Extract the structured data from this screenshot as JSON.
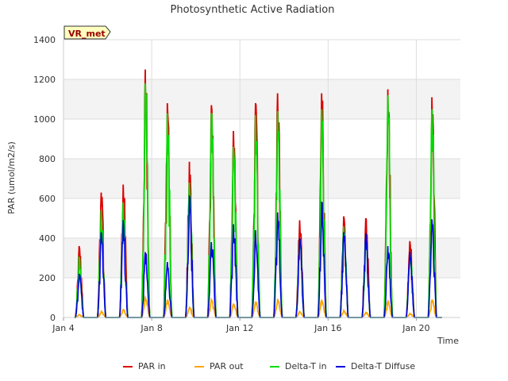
{
  "chart_data": {
    "type": "line",
    "title": "Photosynthetic Active Radiation",
    "xlabel": "Time",
    "ylabel": "PAR (umol/m2/s)",
    "site_label": "VR_met",
    "ylim": [
      0,
      1400
    ],
    "yticks": [
      0,
      200,
      400,
      600,
      800,
      1000,
      1200,
      1400
    ],
    "xlim": [
      "2024-01-04",
      "2024-01-22"
    ],
    "xticks": [
      {
        "date": "2024-01-04",
        "label": "Jan 4"
      },
      {
        "date": "2024-01-08",
        "label": "Jan 8"
      },
      {
        "date": "2024-01-12",
        "label": "Jan 12"
      },
      {
        "date": "2024-01-16",
        "label": "Jan 16"
      },
      {
        "date": "2024-01-20",
        "label": "Jan 20"
      }
    ],
    "grid": true,
    "legend_position": "bottom",
    "series": [
      {
        "name": "PAR in",
        "color": "#dd0000",
        "daily_peak": [
          {
            "date": "2024-01-04",
            "value": 360
          },
          {
            "date": "2024-01-05",
            "value": 630
          },
          {
            "date": "2024-01-06",
            "value": 670
          },
          {
            "date": "2024-01-07",
            "value": 1250
          },
          {
            "date": "2024-01-08",
            "value": 1080
          },
          {
            "date": "2024-01-09",
            "value": 785
          },
          {
            "date": "2024-01-10",
            "value": 1070
          },
          {
            "date": "2024-01-11",
            "value": 940
          },
          {
            "date": "2024-01-12",
            "value": 1080
          },
          {
            "date": "2024-01-13",
            "value": 1130
          },
          {
            "date": "2024-01-14",
            "value": 490
          },
          {
            "date": "2024-01-15",
            "value": 1130
          },
          {
            "date": "2024-01-16",
            "value": 510
          },
          {
            "date": "2024-01-17",
            "value": 500
          },
          {
            "date": "2024-01-18",
            "value": 1150
          },
          {
            "date": "2024-01-19",
            "value": 385
          },
          {
            "date": "2024-01-20",
            "value": 1110
          }
        ]
      },
      {
        "name": "PAR out",
        "color": "#ffa500",
        "daily_peak": [
          {
            "date": "2024-01-04",
            "value": 15
          },
          {
            "date": "2024-01-05",
            "value": 30
          },
          {
            "date": "2024-01-06",
            "value": 40
          },
          {
            "date": "2024-01-07",
            "value": 100
          },
          {
            "date": "2024-01-08",
            "value": 90
          },
          {
            "date": "2024-01-09",
            "value": 50
          },
          {
            "date": "2024-01-10",
            "value": 90
          },
          {
            "date": "2024-01-11",
            "value": 70
          },
          {
            "date": "2024-01-12",
            "value": 80
          },
          {
            "date": "2024-01-13",
            "value": 90
          },
          {
            "date": "2024-01-14",
            "value": 30
          },
          {
            "date": "2024-01-15",
            "value": 90
          },
          {
            "date": "2024-01-16",
            "value": 35
          },
          {
            "date": "2024-01-17",
            "value": 25
          },
          {
            "date": "2024-01-18",
            "value": 80
          },
          {
            "date": "2024-01-19",
            "value": 20
          },
          {
            "date": "2024-01-20",
            "value": 90
          }
        ]
      },
      {
        "name": "Delta-T in",
        "color": "#00dd00",
        "daily_peak": [
          {
            "date": "2024-01-04",
            "value": 300
          },
          {
            "date": "2024-01-05",
            "value": 540
          },
          {
            "date": "2024-01-06",
            "value": 580
          },
          {
            "date": "2024-01-07",
            "value": 1180
          },
          {
            "date": "2024-01-08",
            "value": 1030
          },
          {
            "date": "2024-01-09",
            "value": 680
          },
          {
            "date": "2024-01-10",
            "value": 1030
          },
          {
            "date": "2024-01-11",
            "value": 860
          },
          {
            "date": "2024-01-12",
            "value": 1020
          },
          {
            "date": "2024-01-13",
            "value": 1040
          },
          {
            "date": "2024-01-14",
            "value": 400
          },
          {
            "date": "2024-01-15",
            "value": 1050
          },
          {
            "date": "2024-01-16",
            "value": 460
          },
          {
            "date": "2024-01-17",
            "value": 420
          },
          {
            "date": "2024-01-18",
            "value": 1120
          },
          {
            "date": "2024-01-19",
            "value": 320
          },
          {
            "date": "2024-01-20",
            "value": 1050
          }
        ]
      },
      {
        "name": "Delta-T Diffuse",
        "color": "#0000dd",
        "daily_peak": [
          {
            "date": "2024-01-04",
            "value": 220
          },
          {
            "date": "2024-01-05",
            "value": 430
          },
          {
            "date": "2024-01-06",
            "value": 490
          },
          {
            "date": "2024-01-07",
            "value": 330
          },
          {
            "date": "2024-01-08",
            "value": 280
          },
          {
            "date": "2024-01-09",
            "value": 610
          },
          {
            "date": "2024-01-10",
            "value": 380
          },
          {
            "date": "2024-01-11",
            "value": 470
          },
          {
            "date": "2024-01-12",
            "value": 440
          },
          {
            "date": "2024-01-13",
            "value": 530
          },
          {
            "date": "2024-01-14",
            "value": 400
          },
          {
            "date": "2024-01-15",
            "value": 580
          },
          {
            "date": "2024-01-16",
            "value": 430
          },
          {
            "date": "2024-01-17",
            "value": 425
          },
          {
            "date": "2024-01-18",
            "value": 360
          },
          {
            "date": "2024-01-19",
            "value": 330
          },
          {
            "date": "2024-01-20",
            "value": 495
          }
        ]
      }
    ]
  }
}
